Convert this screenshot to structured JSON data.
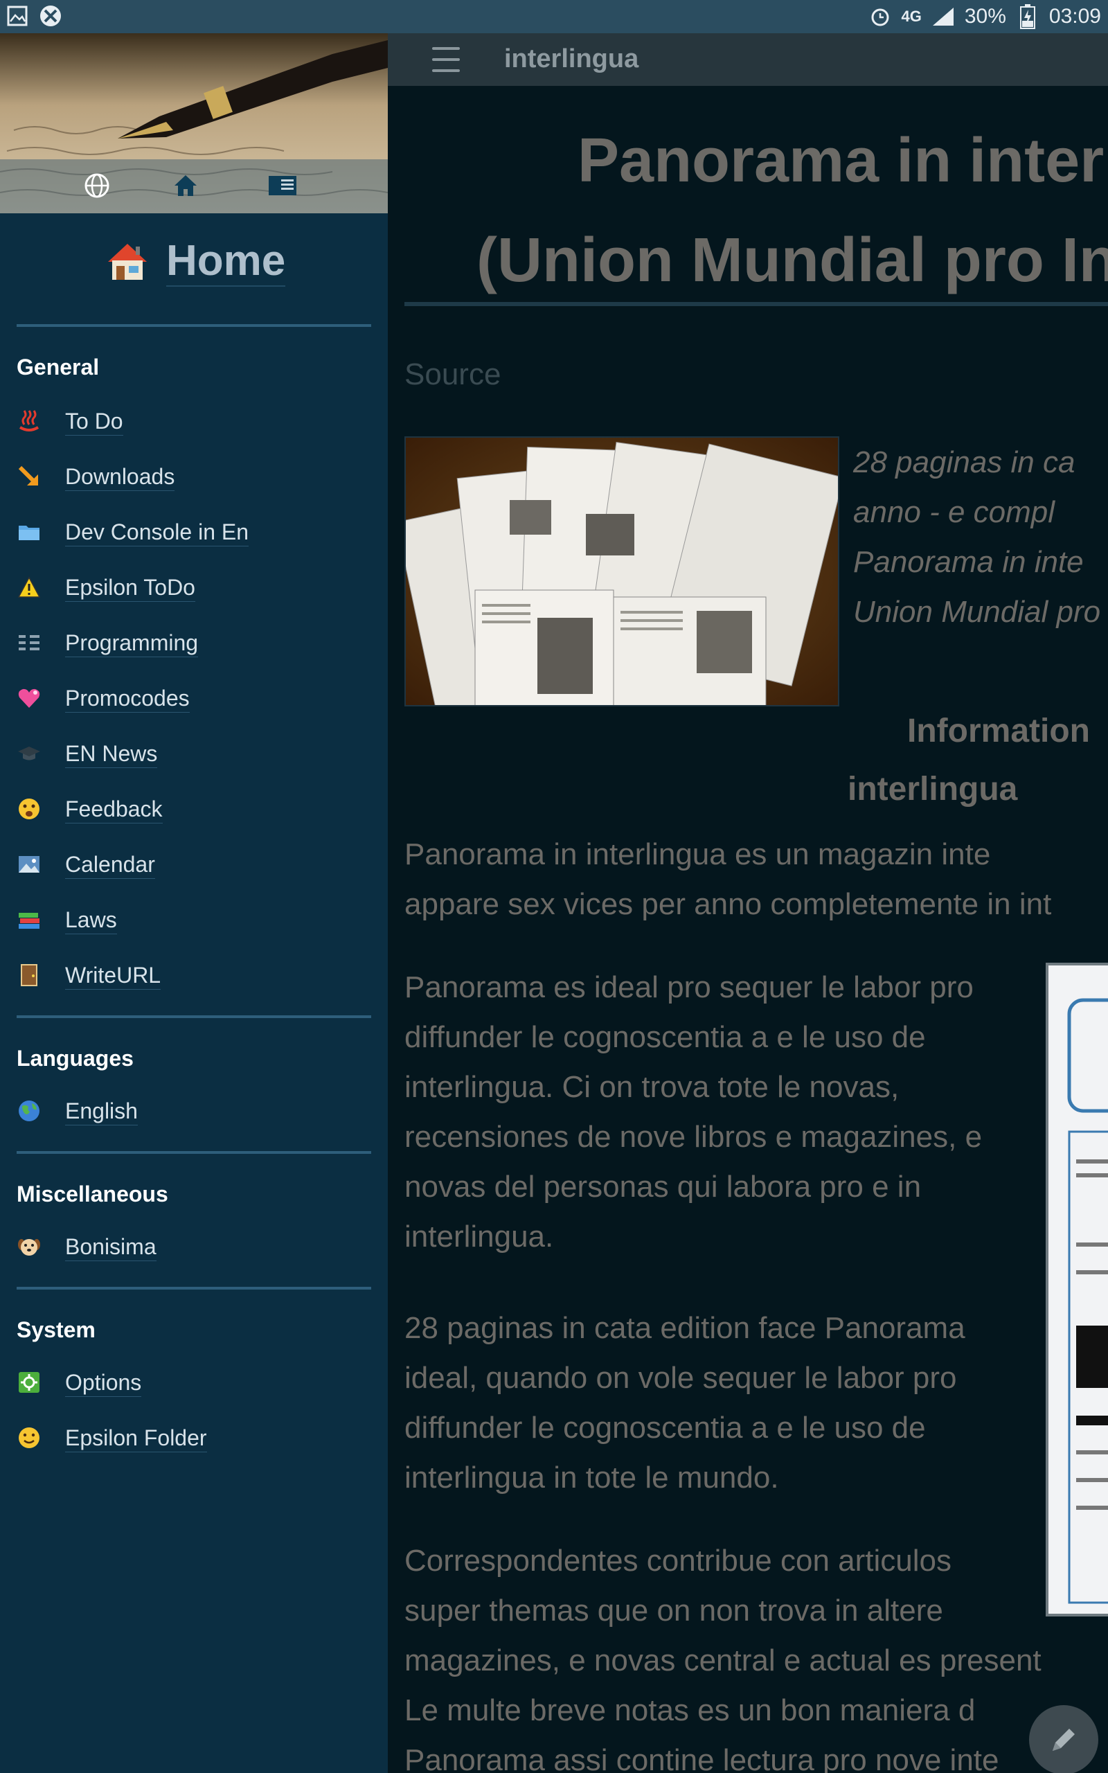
{
  "status_bar": {
    "network": "4G",
    "battery": "30%",
    "time": "03:09"
  },
  "app_bar": {
    "title": "interlingua"
  },
  "drawer": {
    "title": "Home",
    "sections": [
      {
        "heading": "General",
        "items": [
          {
            "label": "To Do",
            "icon": "hot-springs-icon"
          },
          {
            "label": "Downloads",
            "icon": "download-arrow-icon"
          },
          {
            "label": "Dev Console in En",
            "icon": "folder-icon"
          },
          {
            "label": "Epsilon ToDo",
            "icon": "warning-icon"
          },
          {
            "label": "Programming",
            "icon": "list-icon"
          },
          {
            "label": "Promocodes",
            "icon": "heart-icon"
          },
          {
            "label": "EN News",
            "icon": "graduation-cap-icon"
          },
          {
            "label": "Feedback",
            "icon": "face-icon"
          },
          {
            "label": "Calendar",
            "icon": "picture-icon"
          },
          {
            "label": "Laws",
            "icon": "books-icon"
          },
          {
            "label": "WriteURL",
            "icon": "door-icon"
          }
        ]
      },
      {
        "heading": "Languages",
        "items": [
          {
            "label": "English",
            "icon": "globe-icon"
          }
        ]
      },
      {
        "heading": "Miscellaneous",
        "items": [
          {
            "label": "Bonisima",
            "icon": "dog-icon"
          }
        ]
      },
      {
        "heading": "System",
        "items": [
          {
            "label": "Options",
            "icon": "settings-icon"
          },
          {
            "label": "Epsilon Folder",
            "icon": "smiley-icon"
          }
        ]
      }
    ]
  },
  "content": {
    "title_line1": "Panorama in inter",
    "title_line2": "(Union Mundial pro In",
    "source_label": "Source",
    "intro_italic": [
      "28 paginas in ca",
      "anno - e compl",
      "Panorama in inte",
      "Union Mundial pro"
    ],
    "info_heading_line1": "Information",
    "info_heading_line2": "interlingua",
    "p1": [
      "Panorama in interlingua es un magazin inte",
      "appare sex vices per anno completemente in int"
    ],
    "p2": [
      "Panorama es ideal pro sequer le labor pro",
      "diffunder le cognoscentia a e le uso de",
      "interlingua. Ci on trova tote le novas,",
      "recensiones de nove libros e magazines, e",
      "novas del personas qui labora pro e in",
      "interlingua."
    ],
    "p3": [
      "28 paginas in cata edition face Panorama",
      "ideal, quando on vole sequer le labor pro",
      "diffunder le cognoscentia a e le uso de",
      "interlingua in tote le mundo."
    ],
    "p4": [
      "Correspondentes contribue con articulos",
      "super themas que on non trova in altere",
      "magazines, e novas central e actual es present",
      "Le multe breve notas es un bon maniera d",
      "Panorama assi contine lectura pro nove inte"
    ]
  }
}
